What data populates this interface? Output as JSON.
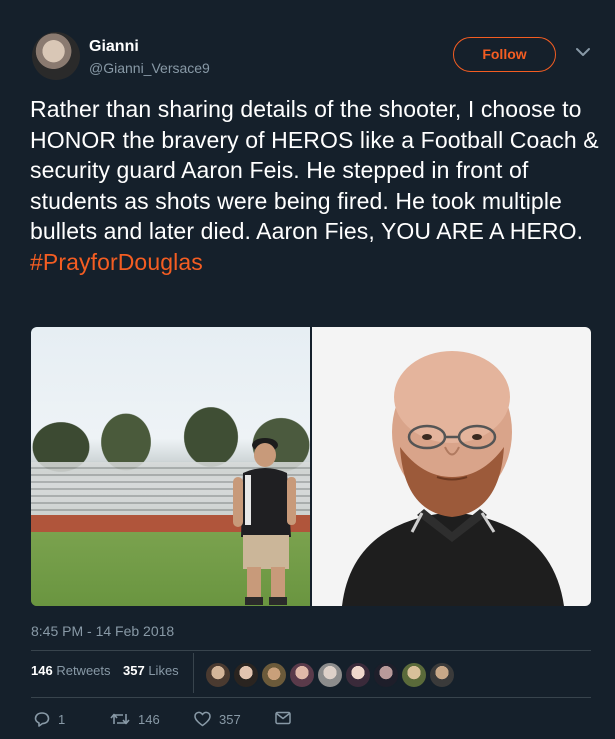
{
  "user": {
    "display_name": "Gianni",
    "handle": "@Gianni_Versace9"
  },
  "header": {
    "follow_label": "Follow",
    "accent_color": "#f45d22"
  },
  "tweet": {
    "text": "Rather than sharing details of the shooter, I choose to HONOR the bravery of HEROS like a Football Coach & security guard Aaron Feis. He stepped in front of students as shots were being fired. He took multiple bullets and later died. Aaron Fies, YOU ARE A HERO.",
    "hashtag": "#PrayforDouglas",
    "timestamp": "8:45 PM - 14 Feb 2018"
  },
  "stats": {
    "retweets_count": "146",
    "retweets_label": "Retweets",
    "likes_count": "357",
    "likes_label": "Likes"
  },
  "actions": {
    "reply_count": "1",
    "retweet_count": "146",
    "like_count": "357"
  },
  "icons": {
    "reply": "reply-icon",
    "retweet": "retweet-icon",
    "like": "heart-icon",
    "message": "envelope-icon",
    "caret": "chevron-down-icon"
  },
  "colors": {
    "background": "#15202b",
    "secondary_text": "#8899a6",
    "divider": "#38444d"
  }
}
